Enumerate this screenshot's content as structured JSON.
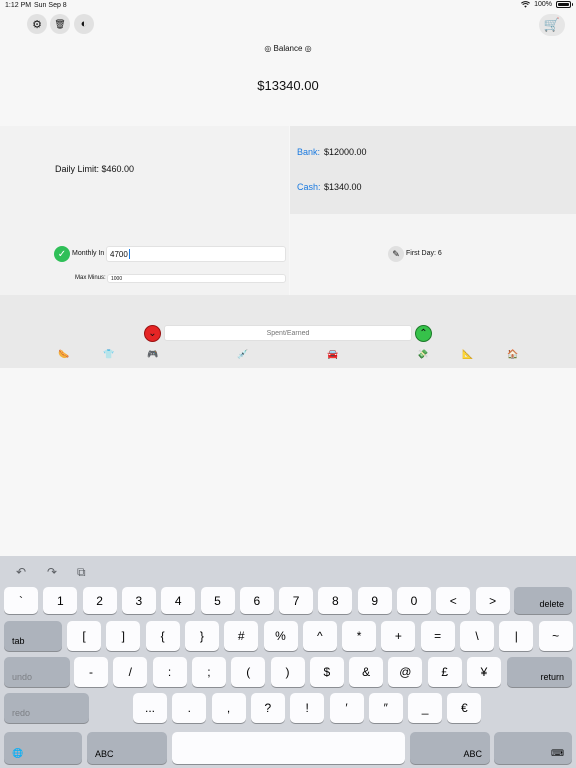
{
  "status_bar": {
    "time": "1:12 PM",
    "date": "Sun Sep 8",
    "battery": "100%"
  },
  "toolbar": {
    "settings_icon": "⚙",
    "trash_icon": "🗑",
    "contrast_icon": "◐",
    "shop_icon": "🛒"
  },
  "balance": {
    "label": "◎ Balance ◎",
    "value": "$13340.00"
  },
  "daily": {
    "label": "Daily Limit: $460.00"
  },
  "accounts": {
    "bank_label": "Bank:",
    "bank_value": "$12000.00",
    "cash_label": "Cash:",
    "cash_value": "$1340.00"
  },
  "monthly": {
    "check_icon": "✓",
    "label": "Monthly In",
    "value": "4700",
    "max_minus_label": "Max Minus:",
    "max_minus_value": "1000"
  },
  "first_day": {
    "edit_icon": "✎",
    "label": "First Day: 6"
  },
  "entry": {
    "placeholder": "Spent/Earned",
    "minus_icon": "⌄",
    "plus_icon": "⌃",
    "categories": [
      "🌭",
      "👕",
      "🎮",
      "💉",
      "🚘",
      "💸",
      "📐",
      "🏠"
    ]
  },
  "keyboard": {
    "tools": [
      "↶",
      "↷",
      "⧉"
    ],
    "row1": [
      "`",
      "1",
      "2",
      "3",
      "4",
      "5",
      "6",
      "7",
      "8",
      "9",
      "0",
      "<",
      ">"
    ],
    "row1_end": "delete",
    "row2_start": "tab",
    "row2": [
      "[",
      "]",
      "{",
      "}",
      "#",
      "%",
      "^",
      "*",
      "+",
      "=",
      "\\",
      "|",
      "~"
    ],
    "row3_start": "undo",
    "row3": [
      "-",
      "/",
      ":",
      ";",
      "(",
      ")",
      "$",
      "&",
      "@",
      "£",
      "¥"
    ],
    "row3_end": "return",
    "row4_start": "redo",
    "row4": [
      "...",
      ".",
      ",",
      "?",
      "!",
      "′",
      "″",
      "_",
      "€"
    ],
    "globe": "🌐",
    "abc_left": "ABC",
    "abc_right": "ABC",
    "dismiss": "⌨"
  }
}
